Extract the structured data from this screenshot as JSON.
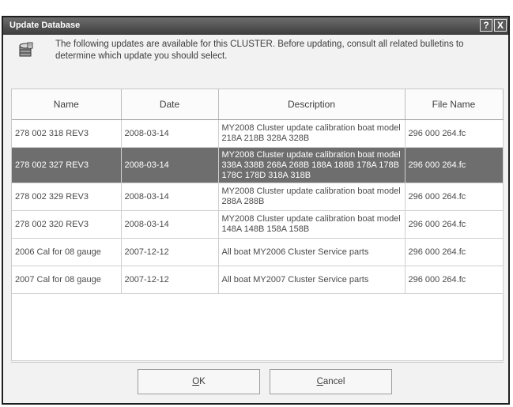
{
  "window": {
    "title": "Update Database",
    "help_glyph": "?",
    "close_glyph": "X"
  },
  "message": {
    "icon": "database-update-icon",
    "text": "The following updates are available for this CLUSTER. Before updating, consult all related bulletins to determine which update you should select."
  },
  "table": {
    "columns": [
      "Name",
      "Date",
      "Description",
      "File Name"
    ],
    "rows": [
      {
        "name": "278 002 318 REV3",
        "date": "2008-03-14",
        "description": "MY2008 Cluster update calibration boat model 218A 218B 328A 328B",
        "file": "296 000 264.fc"
      },
      {
        "name": "278 002 327 REV3",
        "date": "2008-03-14",
        "description": "MY2008 Cluster update calibration boat model 338A 338B 268A 268B 188A 188B 178A 178B 178C 178D 318A 318B",
        "file": "296 000 264.fc"
      },
      {
        "name": "278 002 329 REV3",
        "date": "2008-03-14",
        "description": "MY2008 Cluster update calibration boat model 288A 288B",
        "file": "296 000 264.fc"
      },
      {
        "name": "278 002 320 REV3",
        "date": "2008-03-14",
        "description": "MY2008 Cluster update calibration boat model 148A 148B 158A 158B",
        "file": "296 000 264.fc"
      },
      {
        "name": "2006 Cal for 08 gauge",
        "date": "2007-12-12",
        "description": "All boat MY2006 Cluster Service parts",
        "file": "296 000 264.fc"
      },
      {
        "name": "2007 Cal for 08 gauge",
        "date": "2007-12-12",
        "description": "All boat MY2007 Cluster Service parts",
        "file": "296 000 264.fc"
      }
    ]
  },
  "buttons": {
    "ok_mnemonic": "O",
    "ok_rest": "K",
    "cancel_mnemonic": "C",
    "cancel_rest": "ancel"
  }
}
